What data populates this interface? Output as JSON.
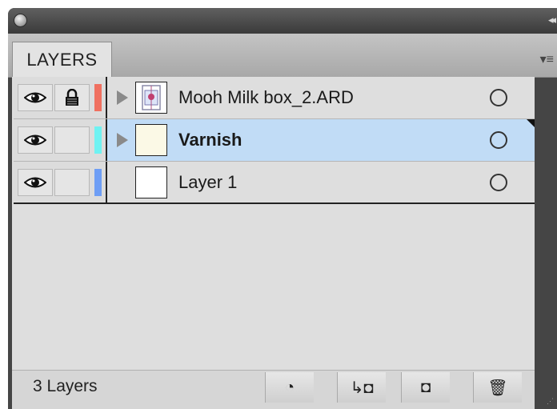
{
  "panel": {
    "tab_label": "LAYERS",
    "collapse_glyph": "◂◂",
    "menu_glyph": "▾≡"
  },
  "layers": [
    {
      "name": "Mooh Milk box_2.ARD",
      "color": "#f07060",
      "locked": true,
      "visible": true,
      "expandable": true,
      "selected": false,
      "thumb": "box"
    },
    {
      "name": "Varnish",
      "color": "#6ff2f2",
      "locked": false,
      "visible": true,
      "expandable": true,
      "selected": true,
      "thumb": "cream"
    },
    {
      "name": "Layer 1",
      "color": "#6e9ef5",
      "locked": false,
      "visible": true,
      "expandable": false,
      "selected": false,
      "thumb": "blank"
    }
  ],
  "footer": {
    "count_text": "3 Layers",
    "buttons": [
      {
        "name": "make-clipping-mask-button",
        "glyph": "◔"
      },
      {
        "name": "create-sublayer-button",
        "glyph": "↳◘"
      },
      {
        "name": "new-layer-button",
        "glyph": "◘"
      },
      {
        "name": "delete-layer-button",
        "glyph": "🗑"
      }
    ]
  }
}
